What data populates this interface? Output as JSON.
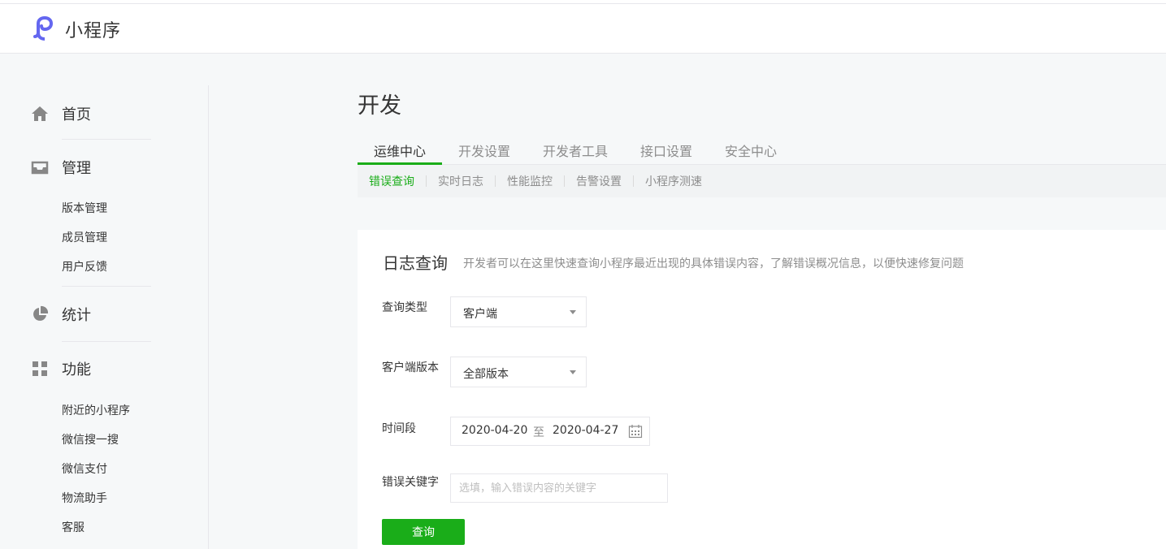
{
  "brand": {
    "name": "小程序"
  },
  "sidebar": {
    "home": {
      "label": "首页",
      "icon": "home-icon"
    },
    "manage": {
      "label": "管理",
      "icon": "inbox-icon",
      "items": [
        "版本管理",
        "成员管理",
        "用户反馈"
      ]
    },
    "stats": {
      "label": "统计",
      "icon": "pie-chart-icon"
    },
    "features": {
      "label": "功能",
      "icon": "grid-icon",
      "items": [
        "附近的小程序",
        "微信搜一搜",
        "微信支付",
        "物流助手",
        "客服"
      ]
    }
  },
  "page": {
    "title": "开发"
  },
  "tabs": [
    "运维中心",
    "开发设置",
    "开发者工具",
    "接口设置",
    "安全中心"
  ],
  "active_tab": "运维中心",
  "subtabs": [
    "错误查询",
    "实时日志",
    "性能监控",
    "告警设置",
    "小程序测速"
  ],
  "active_subtab": "错误查询",
  "panel": {
    "title": "日志查询",
    "desc": "开发者可以在这里快速查询小程序最近出现的具体错误内容，了解错误概况信息，以便快速修复问题"
  },
  "form": {
    "query_type": {
      "label": "查询类型",
      "value": "客户端"
    },
    "client_version": {
      "label": "客户端版本",
      "value": "全部版本"
    },
    "period": {
      "label": "时间段",
      "start": "2020-04-20",
      "sep": "至",
      "end": "2020-04-27"
    },
    "keyword": {
      "label": "错误关键字",
      "placeholder": "选填，输入错误内容的关键字"
    },
    "submit": "查询"
  },
  "colors": {
    "accent": "#1aad19",
    "logo": "#6467f0",
    "icon": "#878787"
  }
}
